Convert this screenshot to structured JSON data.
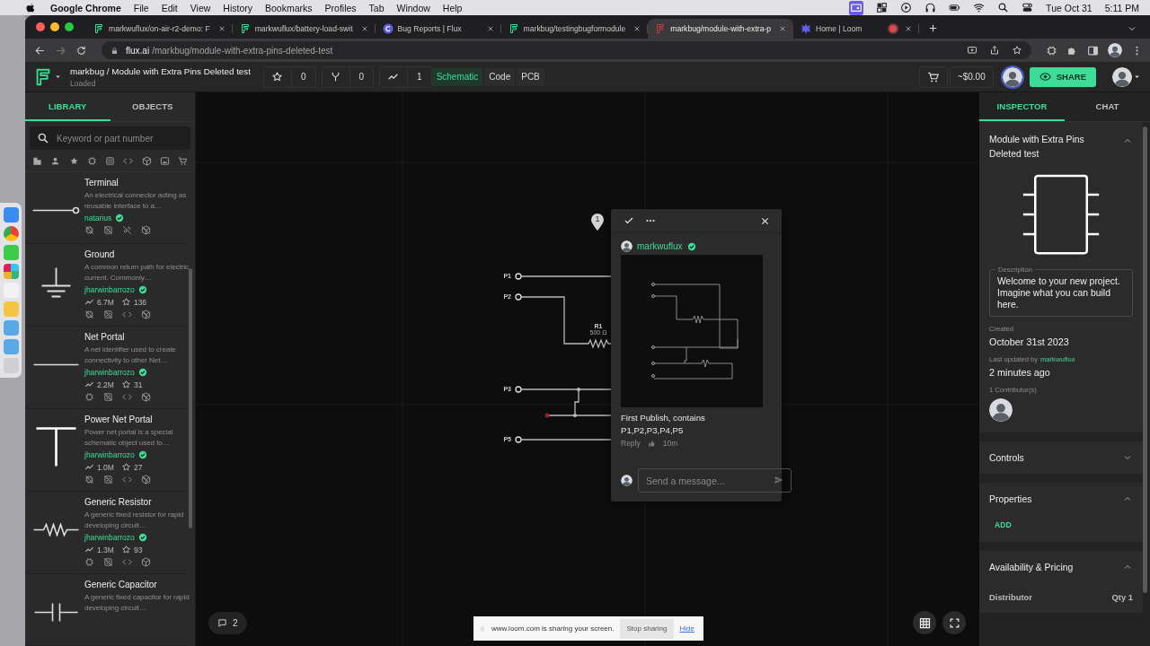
{
  "menubar": {
    "app": "Google Chrome",
    "menus": [
      "File",
      "Edit",
      "View",
      "History",
      "Bookmarks",
      "Profiles",
      "Tab",
      "Window",
      "Help"
    ],
    "date": "Tue Oct 31",
    "time": "5:11 PM"
  },
  "browser": {
    "tabs": [
      {
        "title": "markwuflux/on-air-r2-demo: F",
        "kind": "flux",
        "color": "#3ddc97",
        "selected": false,
        "recording": false
      },
      {
        "title": "markwuflux/battery-load-swit",
        "kind": "flux",
        "color": "#3ddc97",
        "selected": false,
        "recording": false
      },
      {
        "title": "Bug Reports | Flux",
        "kind": "letter",
        "color": "#5b5ce6",
        "selected": false,
        "recording": false
      },
      {
        "title": "markbug/testingbugformodule",
        "kind": "flux",
        "color": "#3ddc97",
        "selected": false,
        "recording": false
      },
      {
        "title": "markbug/module-with-extra-p",
        "kind": "flux",
        "color": "#c83a3a",
        "selected": true,
        "recording": false
      },
      {
        "title": "Home | Loom",
        "kind": "loom",
        "color": "#625df5",
        "selected": false,
        "recording": true
      }
    ],
    "url_host": "flux.ai",
    "url_path": "/markbug/module-with-extra-pins-deleted-test"
  },
  "app": {
    "title": "markbug / Module with Extra Pins Deleted test",
    "status": "Loaded",
    "stats": [
      {
        "kind": "star",
        "count": "0"
      },
      {
        "kind": "fork",
        "count": "0"
      },
      {
        "kind": "trend",
        "count": "1"
      }
    ],
    "views": [
      {
        "label": "Schematic",
        "selected": true
      },
      {
        "label": "Code",
        "selected": false
      },
      {
        "label": "PCB",
        "selected": false
      }
    ],
    "price": "~$0.00",
    "share": "SHARE"
  },
  "library": {
    "tabs": [
      {
        "label": "LIBRARY",
        "selected": true
      },
      {
        "label": "OBJECTS",
        "selected": false
      }
    ],
    "search": {
      "placeholder": "Keyword or part number"
    },
    "parts": [
      {
        "name": "Terminal",
        "kind": "terminal",
        "description": "An electrical connector acting as reusable interface to a…",
        "author": "natarius",
        "verified": true,
        "assets": [
          {
            "kind": "chip",
            "available": false
          },
          {
            "kind": "footprint",
            "available": false
          },
          {
            "kind": "link",
            "available": false
          },
          {
            "kind": "cube",
            "available": false
          }
        ]
      },
      {
        "name": "Ground",
        "kind": "ground",
        "description": "A common return path for electric current. Commonly…",
        "author": "jharwinbarrozo",
        "verified": true,
        "downloads": "6.7M",
        "star_count": "136",
        "assets": [
          {
            "kind": "chip",
            "available": false
          },
          {
            "kind": "footprint",
            "available": false
          },
          {
            "kind": "code",
            "available": true
          },
          {
            "kind": "cube",
            "available": false
          }
        ]
      },
      {
        "name": "Net Portal",
        "kind": "net-portal",
        "description": "A net identifier used to create connectivity to other Net…",
        "author": "jharwinbarrozo",
        "verified": true,
        "downloads": "2.2M",
        "star_count": "31",
        "assets": [
          {
            "kind": "chip",
            "available": true
          },
          {
            "kind": "footprint",
            "available": false
          },
          {
            "kind": "code",
            "available": true
          },
          {
            "kind": "cube",
            "available": false
          }
        ]
      },
      {
        "name": "Power Net Portal",
        "kind": "power-net-portal",
        "description": "Power net portal is a special schematic object used to…",
        "author": "jharwinbarrozo",
        "verified": true,
        "downloads": "1.0M",
        "star_count": "27",
        "assets": [
          {
            "kind": "chip",
            "available": false
          },
          {
            "kind": "footprint",
            "available": false
          },
          {
            "kind": "code",
            "available": true
          },
          {
            "kind": "cube",
            "available": false
          }
        ]
      },
      {
        "name": "Generic Resistor",
        "kind": "resistor",
        "description": "A generic fixed resistor for rapid developing circuit…",
        "author": "jharwinbarrozo",
        "verified": true,
        "downloads": "1.3M",
        "star_count": "93",
        "assets": [
          {
            "kind": "chip",
            "available": true
          },
          {
            "kind": "footprint",
            "available": false
          },
          {
            "kind": "code",
            "available": true
          },
          {
            "kind": "cube",
            "available": true
          }
        ]
      },
      {
        "name": "Generic Capacitor",
        "kind": "capacitor",
        "description": "A generic fixed capacitor for rapid developing circuit…"
      }
    ]
  },
  "canvas": {
    "pins": [
      {
        "label": "P1"
      },
      {
        "label": "P2"
      },
      {
        "label": "P3"
      },
      {
        "label": "P5"
      }
    ],
    "resistor": {
      "name": "R1",
      "value": "500 Ω"
    },
    "comment_pins": [
      {
        "label": "1"
      }
    ],
    "comment": {
      "author": "markwuflux",
      "verified": true,
      "text": "First Publish, contains P1,P2,P3,P4,P5",
      "reply": "Reply",
      "age": "10m",
      "input": {
        "placeholder": "Send a message..."
      }
    },
    "comments_count": "2",
    "share_notice": {
      "text": "www.loom.com is sharing your screen.",
      "stop": "Stop sharing",
      "hide": "Hide"
    }
  },
  "inspector": {
    "tabs": [
      {
        "label": "INSPECTOR",
        "selected": true
      },
      {
        "label": "CHAT",
        "selected": false
      }
    ],
    "title": "Module with Extra Pins Deleted test",
    "expanded": true,
    "description_label": "Description",
    "description": "Welcome to your new project. Imagine what you can build here.",
    "created_label": "Created",
    "created": "October 31st 2023",
    "updated_label": "Last updated by",
    "updated_by": "markwuflux",
    "updated": "2 minutes ago",
    "contributors_label": "1 Contributor(s)",
    "sections": [
      {
        "title": "Controls",
        "expanded": false
      },
      {
        "title": "Properties",
        "expanded": true,
        "action": "ADD"
      },
      {
        "title": "Availability & Pricing",
        "expanded": true,
        "column_1": "Distributor",
        "column_2": "Qty 1"
      }
    ]
  }
}
